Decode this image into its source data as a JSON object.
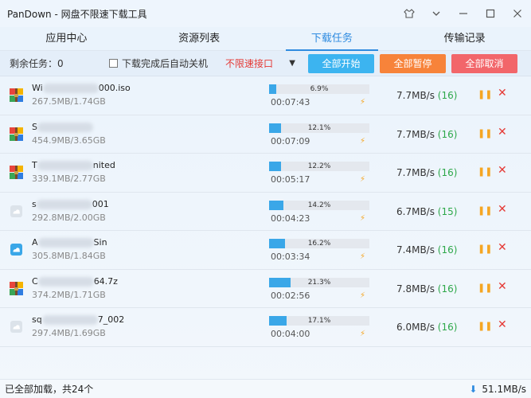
{
  "app": {
    "title": "PanDown - 网盘不限速下载工具"
  },
  "window_controls": [
    {
      "name": "skin-icon",
      "glyph": "⌂"
    },
    {
      "name": "menu-chevron-icon",
      "glyph": "∨"
    },
    {
      "name": "minimize-icon",
      "glyph": "—"
    },
    {
      "name": "maximize-icon",
      "glyph": "☐"
    },
    {
      "name": "close-window-icon",
      "glyph": "✕"
    }
  ],
  "tabs": [
    {
      "label": "应用中心",
      "active": false
    },
    {
      "label": "资源列表",
      "active": false
    },
    {
      "label": "下载任务",
      "active": true
    },
    {
      "label": "传输记录",
      "active": false
    }
  ],
  "toolbar": {
    "remaining_label": "剩余任务：0",
    "auto_shutdown_label": "下载完成后自动关机",
    "auto_shutdown_checked": false,
    "interface_selected": "不限速接口",
    "start_all": "全部开始",
    "pause_all": "全部暂停",
    "cancel_all": "全部取消"
  },
  "tasks": [
    {
      "icon": "archive",
      "name_prefix": "Wi",
      "name_suffix": "000.iso",
      "size": "267.5MB/1.74GB",
      "progress": 6.9,
      "percent": "6.9%",
      "eta": "00:07:43",
      "speed": "7.7MB/s",
      "connections": "(16)"
    },
    {
      "icon": "archive",
      "name_prefix": "S",
      "name_suffix": "",
      "size": "454.9MB/3.65GB",
      "progress": 12.1,
      "percent": "12.1%",
      "eta": "00:07:09",
      "speed": "7.7MB/s",
      "connections": "(16)"
    },
    {
      "icon": "archive",
      "name_prefix": "T",
      "name_suffix": "nited",
      "size": "339.1MB/2.77GB",
      "progress": 12.2,
      "percent": "12.2%",
      "eta": "00:05:17",
      "speed": "7.7MB/s",
      "connections": "(16)"
    },
    {
      "icon": "generic",
      "name_prefix": "s",
      "name_suffix": "001",
      "size": "292.8MB/2.00GB",
      "progress": 14.2,
      "percent": "14.2%",
      "eta": "00:04:23",
      "speed": "6.7MB/s",
      "connections": "(15)"
    },
    {
      "icon": "cloud",
      "name_prefix": "A",
      "name_suffix": "Sin",
      "size": "305.8MB/1.84GB",
      "progress": 16.2,
      "percent": "16.2%",
      "eta": "00:03:34",
      "speed": "7.4MB/s",
      "connections": "(16)"
    },
    {
      "icon": "archive",
      "name_prefix": "C",
      "name_suffix": "64.7z",
      "size": "374.2MB/1.71GB",
      "progress": 21.3,
      "percent": "21.3%",
      "eta": "00:02:56",
      "speed": "7.8MB/s",
      "connections": "(16)"
    },
    {
      "icon": "generic",
      "name_prefix": "sq",
      "name_suffix": "7_002",
      "size": "297.4MB/1.69GB",
      "progress": 17.1,
      "percent": "17.1%",
      "eta": "00:04:00",
      "speed": "6.0MB/s",
      "connections": "(16)"
    }
  ],
  "status": {
    "loaded_text": "已全部加载，共24个",
    "total_speed": "51.1MB/s"
  },
  "colors": {
    "accent": "#2f8be0",
    "progress": "#3aa7e8",
    "start": "#3cb4f0",
    "pause": "#f7833a",
    "cancel": "#f2666a"
  }
}
